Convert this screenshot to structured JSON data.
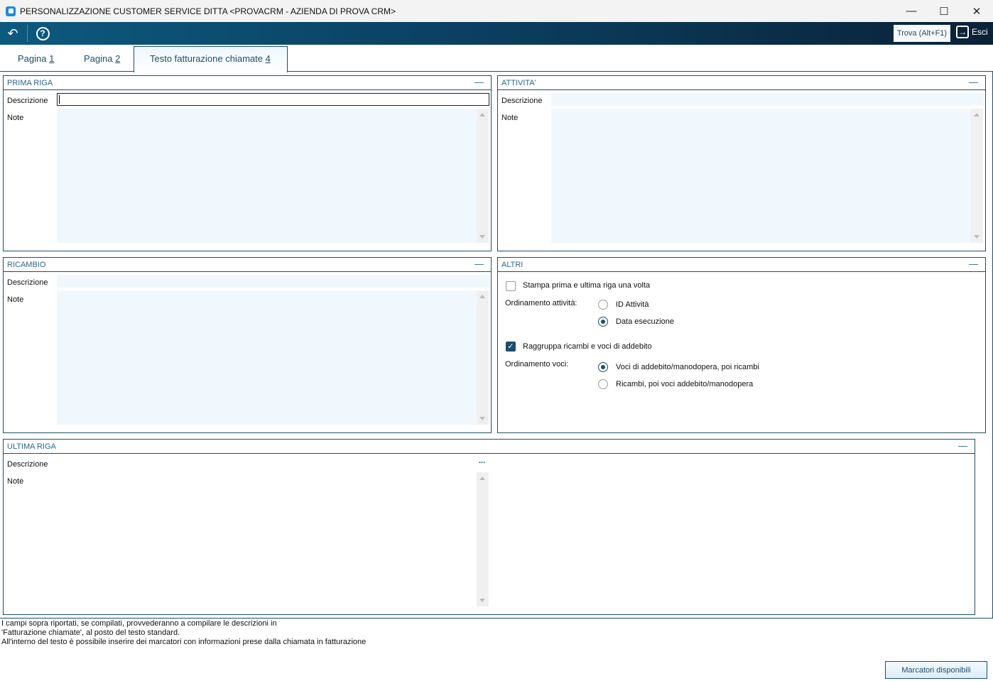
{
  "window": {
    "title": "PERSONALIZZAZIONE CUSTOMER SERVICE DITTA <PROVACRM - AZIENDA DI PROVA CRM>"
  },
  "toolbar": {
    "search_label": "Trova (Alt+F1)",
    "exit_label": "Esci"
  },
  "tabs": [
    {
      "label": "Pagina ",
      "key": "1"
    },
    {
      "label": "Pagina ",
      "key": "2"
    },
    {
      "label": "Testo fatturazione chiamate ",
      "key": "4"
    }
  ],
  "panels": {
    "prima_riga": {
      "title": "PRIMA RIGA",
      "descrizione_label": "Descrizione",
      "note_label": "Note",
      "descrizione": "",
      "note": ""
    },
    "attivita": {
      "title": "ATTIVITA'",
      "descrizione_label": "Descrizione",
      "note_label": "Note",
      "descrizione": "",
      "note": ""
    },
    "ricambio": {
      "title": "RICAMBIO",
      "descrizione_label": "Descrizione",
      "note_label": "Note",
      "descrizione": "",
      "note": ""
    },
    "ultima_riga": {
      "title": "ULTIMA RIGA",
      "descrizione_label": "Descrizione",
      "note_label": "Note",
      "ellipsis": "...",
      "note": ""
    },
    "altri": {
      "title": "ALTRI",
      "stampa_label": "Stampa prima e ultima riga una volta",
      "stampa_checked": false,
      "ord_attivita_label": "Ordinamento attività:",
      "ord_attivita_options": [
        "ID Attività",
        "Data esecuzione"
      ],
      "ord_attivita_selected": "Data esecuzione",
      "raggruppa_label": "Raggruppa ricambi e voci di addebito",
      "raggruppa_checked": true,
      "ord_voci_label": "Ordinamento voci:",
      "ord_voci_options": [
        "Voci di addebito/manodopera, poi ricambi",
        "Ricambi, poi voci addebito/manodopera"
      ],
      "ord_voci_selected": "Voci di addebito/manodopera, poi ricambi"
    }
  },
  "footer": {
    "lines": [
      "I campi sopra riportati, se compilati, provvederanno a compilare le descrizioni in",
      "'Fatturazione chiamate', al posto del testo standard.",
      "All'interno del testo è possibile inserire dei marcatori con informazioni prese dalla chiamata in fatturazione"
    ],
    "button_label": "Marcatori disponibili"
  }
}
